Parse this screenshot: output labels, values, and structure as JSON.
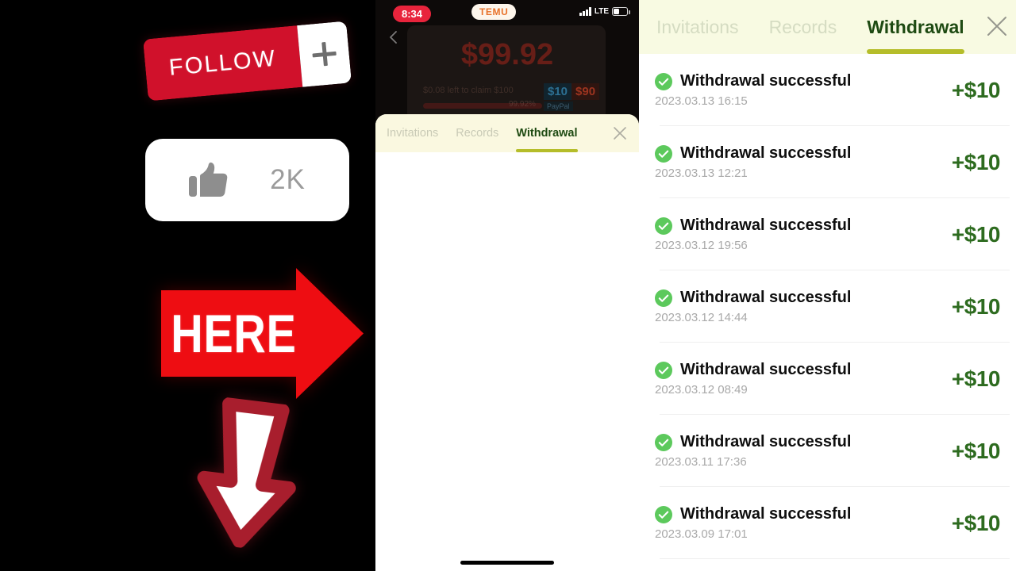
{
  "promo": {
    "follow": {
      "label": "FOLLOW",
      "plus_icon": "plus-icon",
      "color": "#d0112b"
    },
    "like": {
      "count": "2K",
      "icon": "thumbs-up-icon"
    },
    "here_arrow": {
      "label": "HERE",
      "color": "#ee0d12"
    },
    "down_arrow": {
      "icon": "arrow-down-icon",
      "color": "#a81e2d"
    }
  },
  "phone": {
    "status": {
      "time": "8:34",
      "brand": "TEMU",
      "network": "LTE",
      "signal_icon": "cellular-signal-icon",
      "battery_icon": "battery-icon"
    },
    "background": {
      "amount": "$99.92",
      "subtext": "$0.08 left to claim $100",
      "percent": "99.92%",
      "chip_a": "$10",
      "chip_b": "$90",
      "chip_c": "PayPal"
    },
    "back_icon": "back-chevron-icon",
    "sheet": {
      "tabs": [
        {
          "label": "Invitations",
          "active": false
        },
        {
          "label": "Records",
          "active": false
        },
        {
          "label": "Withdrawal",
          "active": true
        }
      ],
      "close_icon": "close-icon"
    },
    "home_indicator": "home-indicator"
  },
  "withdrawal_panel": {
    "tabs": [
      {
        "label": "Invitations",
        "active": false
      },
      {
        "label": "Records",
        "active": false
      },
      {
        "label": "Withdrawal",
        "active": true
      }
    ],
    "close_icon": "close-icon",
    "accent_color": "#b5bd2a",
    "amount_color": "#2d6b1f",
    "check_color": "#5cc95c",
    "rows": [
      {
        "status": "Withdrawal successful",
        "date": "2023.03.13 16:15",
        "amount": "+$10",
        "icon": "check-circle-icon"
      },
      {
        "status": "Withdrawal successful",
        "date": "2023.03.13 12:21",
        "amount": "+$10",
        "icon": "check-circle-icon"
      },
      {
        "status": "Withdrawal successful",
        "date": "2023.03.12 19:56",
        "amount": "+$10",
        "icon": "check-circle-icon"
      },
      {
        "status": "Withdrawal successful",
        "date": "2023.03.12 14:44",
        "amount": "+$10",
        "icon": "check-circle-icon"
      },
      {
        "status": "Withdrawal successful",
        "date": "2023.03.12 08:49",
        "amount": "+$10",
        "icon": "check-circle-icon"
      },
      {
        "status": "Withdrawal successful",
        "date": "2023.03.11 17:36",
        "amount": "+$10",
        "icon": "check-circle-icon"
      },
      {
        "status": "Withdrawal successful",
        "date": "2023.03.09 17:01",
        "amount": "+$10",
        "icon": "check-circle-icon"
      }
    ]
  }
}
